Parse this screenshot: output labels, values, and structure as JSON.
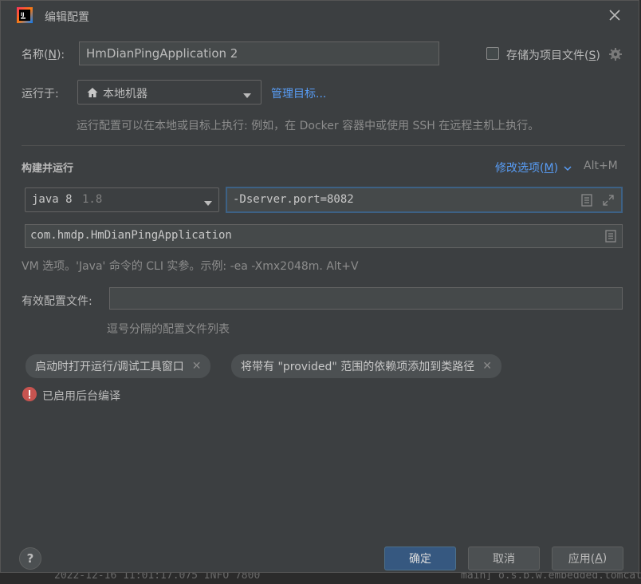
{
  "ide_background": {
    "log_left": "2022-12-16 11:01:17.075  INFO 7800",
    "log_right": "main] o.s.b.w.embedded.tomcat"
  },
  "dialog": {
    "title": "编辑配置",
    "name_label_prefix": "名称(",
    "name_label_mnemonic": "N",
    "name_label_suffix": "):",
    "name_value": "HmDianPingApplication 2",
    "store_as_file_prefix": "存储为项目文件(",
    "store_as_file_mnemonic": "S",
    "store_as_file_suffix": ")",
    "run_on_label": "运行于:",
    "run_on_value": "本地机器",
    "manage_targets": "管理目标...",
    "run_on_hint": "运行配置可以在本地或目标上执行: 例如，在 Docker 容器中或使用 SSH 在远程主机上执行。",
    "build_run_title": "构建并运行",
    "modify_options_prefix": "修改选项(",
    "modify_options_mnemonic": "M",
    "modify_options_suffix": ")",
    "modify_options_shortcut": "Alt+M",
    "jre_name": "java 8",
    "jre_version": "1.8",
    "vm_options_value": "-Dserver.port=8082",
    "main_class_value": "com.hmdp.HmDianPingApplication",
    "vm_hint": "VM 选项。'Java' 命令的 CLI 实参。示例: -ea -Xmx2048m. Alt+V",
    "active_profiles_label": "有效配置文件:",
    "active_profiles_value": "",
    "profiles_hint": "逗号分隔的配置文件列表",
    "chip_1": "启动时打开运行/调试工具窗口",
    "chip_2": "将带有 \"provided\" 范围的依赖项添加到类路径",
    "warning_text": "已启用后台编译",
    "ok_label": "确定",
    "cancel_label": "取消",
    "apply_prefix": "应用(",
    "apply_mnemonic": "A",
    "apply_suffix": ")",
    "help_label": "?"
  },
  "colors": {
    "accent_link": "#589df6",
    "primary_button": "#365880",
    "error_icon": "#c75450",
    "dialog_bg": "#3c3f41"
  }
}
